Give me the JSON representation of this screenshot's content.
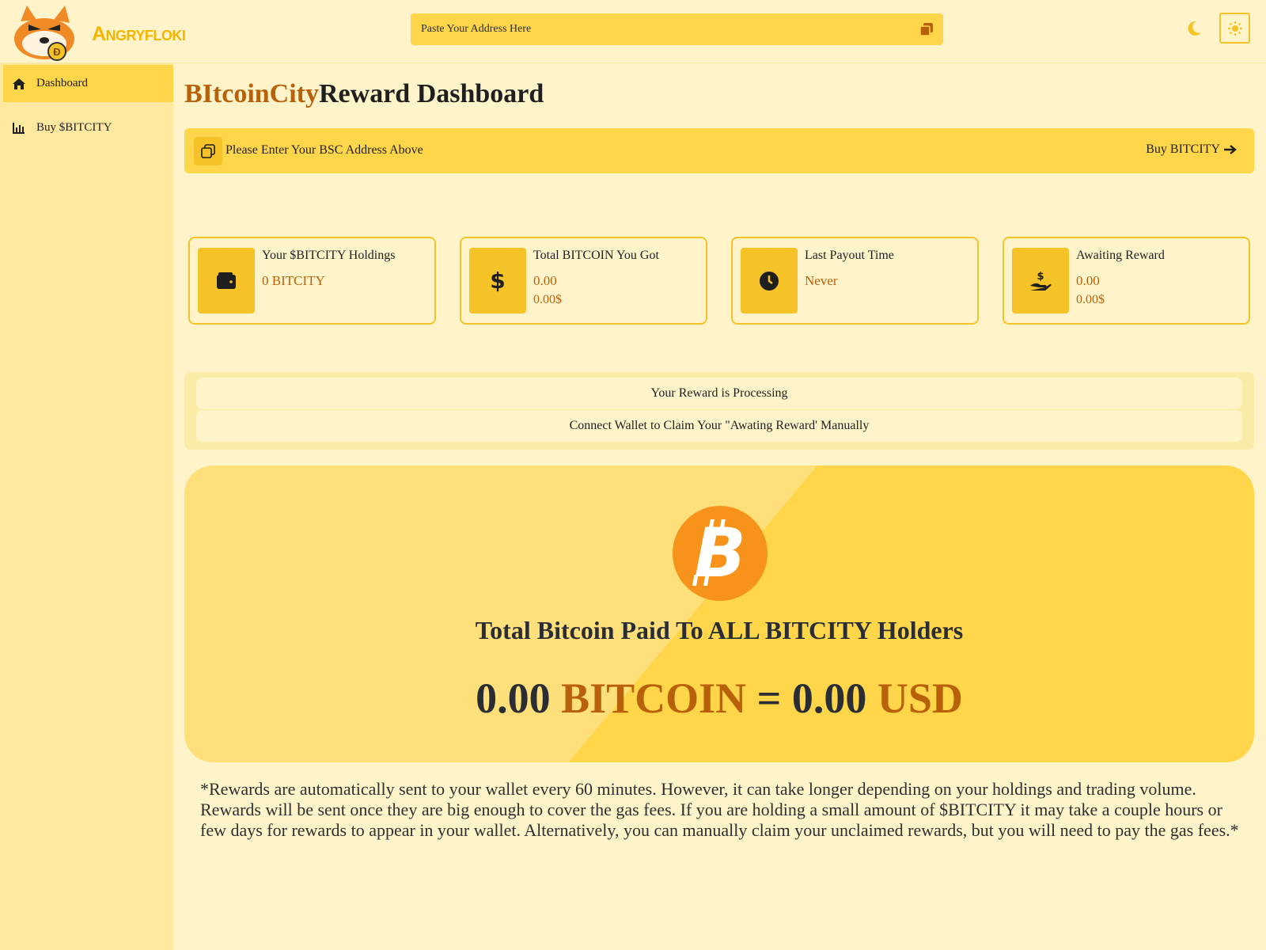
{
  "header": {
    "logo_text": "Angryfloki",
    "search_placeholder": "Paste Your Address Here",
    "icons": [
      "copy-icon",
      "moon-icon",
      "sun-icon"
    ]
  },
  "sidebar": {
    "items": [
      {
        "label": "Dashboard",
        "icon": "home-icon",
        "active": true
      },
      {
        "label": "Buy $BITCITY",
        "icon": "chart-icon",
        "active": false
      }
    ]
  },
  "main": {
    "title_brand": "BItcoinCity",
    "title_rest": "Reward Dashboard",
    "notice_text": "Please Enter Your BSC Address Above",
    "notice_buy": "Buy BITCITY"
  },
  "cards": [
    {
      "label": "Your $BITCITY Holdings",
      "value1": "0 BITCITY",
      "value2": "",
      "icon": "wallet-icon"
    },
    {
      "label": "Total BITCOIN You Got",
      "value1": "0.00",
      "value2": "0.00$",
      "icon": "dollar-icon"
    },
    {
      "label": "Last Payout Time",
      "value1": "Never",
      "value2": "",
      "icon": "clock-icon"
    },
    {
      "label": "Awaiting Reward",
      "value1": "0.00",
      "value2": "0.00$",
      "icon": "hand-dollar-icon"
    }
  ],
  "status": {
    "line1": "Your Reward is Processing",
    "line2": "Connect Wallet to Claim Your \"Awating Reward' Manually"
  },
  "hero": {
    "title": "Total Bitcoin Paid To ALL BITCITY Holders",
    "btc_amount": "0.00",
    "btc_unit": "BITCOIN",
    "equals": "=",
    "usd_amount": "0.00",
    "usd_unit": "USD"
  },
  "footnote": "*Rewards are automatically sent to your wallet every 60 minutes. However, it can take longer depending on your holdings and trading volume. Rewards will be sent once they are big enough to cover the gas fees. If you are holding a small amount of $BITCITY it may take a couple hours or few days for rewards to appear in your wallet. Alternatively, you can manually claim your unclaimed rewards, but you will need to pay the gas fees.*",
  "colors": {
    "accent": "#ffd54a",
    "accent_dark": "#f5c227",
    "brand_text": "#b8610a",
    "background": "#fff4c9"
  }
}
